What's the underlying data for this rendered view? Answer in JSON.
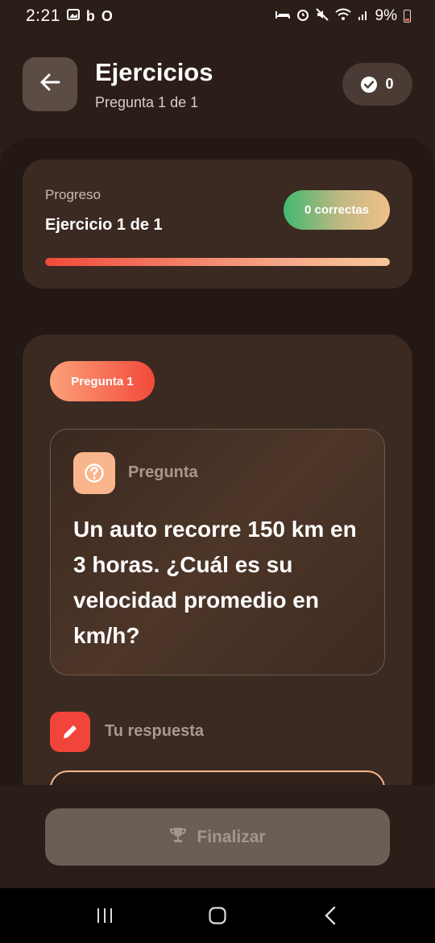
{
  "status_bar": {
    "time": "2:21",
    "battery": "9%"
  },
  "header": {
    "title": "Ejercicios",
    "subtitle": "Pregunta 1 de 1",
    "score": "0"
  },
  "progress": {
    "label": "Progreso",
    "title": "Ejercicio 1 de 1",
    "correct_badge": "0 correctas",
    "fraction": 1.0
  },
  "question": {
    "tag": "Pregunta 1",
    "section_label": "Pregunta",
    "text": "Un auto recorre 150 km en 3 horas. ¿Cuál es su velocidad promedio en km/h?"
  },
  "answer": {
    "label": "Tu respuesta"
  },
  "footer": {
    "finish_label": "Finalizar"
  },
  "colors": {
    "background": "#2b1d17",
    "accent_red": "#f1443a",
    "accent_peach": "#f9b58b",
    "success_green": "#41b870"
  },
  "icons": [
    "back-arrow-icon",
    "check-circle-icon",
    "question-icon",
    "pencil-icon",
    "trophy-icon"
  ]
}
